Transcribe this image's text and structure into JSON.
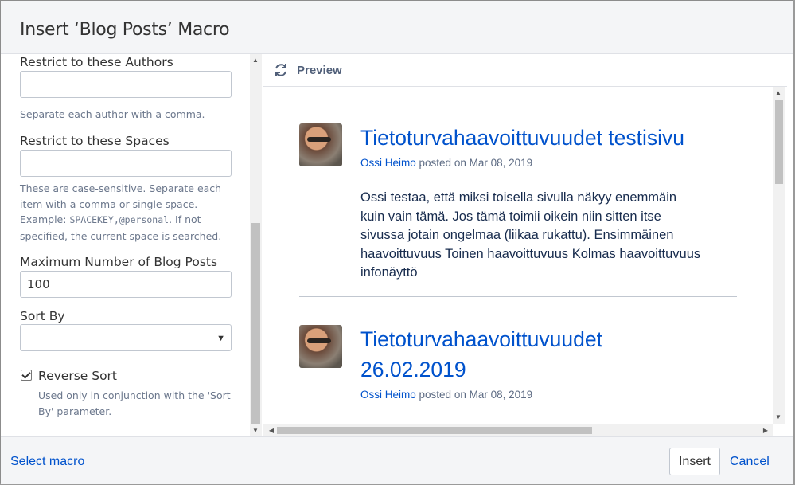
{
  "dialog": {
    "title": "Insert ‘Blog Posts’ Macro"
  },
  "form": {
    "authors": {
      "label": "Restrict to these Authors",
      "value": "",
      "help": "Separate each author with a comma."
    },
    "spaces": {
      "label": "Restrict to these Spaces",
      "value": "",
      "help_1": "These are case-sensitive. Separate each item with a comma or single space. Example:",
      "help_code": "SPACEKEY,@personal",
      "help_2": ". If not specified, the current space is searched."
    },
    "max_posts": {
      "label": "Maximum Number of Blog Posts",
      "value": "100"
    },
    "sort_by": {
      "label": "Sort By",
      "selected": ""
    },
    "reverse_sort": {
      "label": "Reverse Sort",
      "checked": true,
      "help": "Used only in conjunction with the 'Sort By' parameter."
    }
  },
  "preview": {
    "label": "Preview",
    "posts": [
      {
        "title": "Tietoturvahaavoittuvuudet testisivu",
        "author": "Ossi Heimo",
        "posted": "posted on Mar 08, 2019",
        "excerpt": "Ossi testaa, että miksi toisella sivulla näkyy enemmäin kuin vain tämä. Jos tämä toimii oikein niin sitten itse sivussa jotain ongelmaa (liikaa rukattu). Ensimmäinen haavoittuvuus Toinen haavoittuvuus Kolmas haavoittuvuus infonäyttö"
      },
      {
        "title_line1": "Tietoturvahaavoittuvuudet",
        "title_line2": "26.02.2019",
        "author": "Ossi Heimo",
        "posted": "posted on Mar 08, 2019"
      }
    ]
  },
  "footer": {
    "select_macro": "Select macro",
    "insert": "Insert",
    "cancel": "Cancel"
  },
  "colors": {
    "link": "#0052cc",
    "header_bg": "#f4f5f7",
    "border": "#dfe1e6"
  },
  "icons": {
    "refresh": "refresh-icon",
    "sort_dropdown": "chevron-down-icon"
  }
}
